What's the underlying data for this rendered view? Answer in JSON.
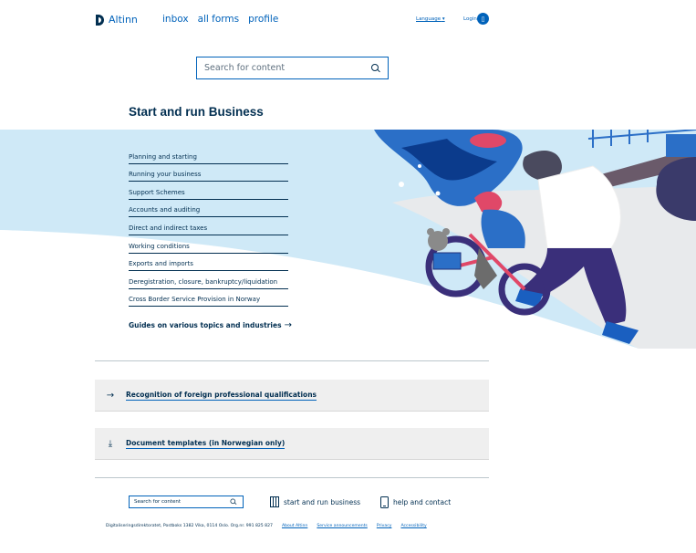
{
  "header": {
    "logo_text": "Altinn",
    "nav": [
      "inbox",
      "all forms",
      "profile"
    ],
    "language_label": "Language",
    "login_label": "Login"
  },
  "search": {
    "placeholder": "Search for content"
  },
  "page_title": "Start and run Business",
  "categories": [
    "Planning and starting",
    "Running your business",
    "Support Schemes",
    "Accounts and auditing",
    "Direct and indirect taxes",
    "Working conditions",
    "Exports and imports",
    "Deregistration, closure, bankruptcy/liquidation",
    "Cross Border Service Provision in Norway"
  ],
  "guides_link": "Guides on various topics and industries",
  "accordions": [
    {
      "label": "Recognition of foreign professional qualifications",
      "icon": "arrow-right-icon"
    },
    {
      "label": "Document templates (in Norwegian only)",
      "icon": "download-icon"
    }
  ],
  "footer": {
    "search_placeholder": "Search for content",
    "links": [
      "start and run business",
      "help and contact"
    ],
    "address": "Digitaliseringsdirektoratet, Postboks 1382 Vika, 0114 Oslo. Org.nr. 991 825 827",
    "bottom_links": [
      "About Altinn",
      "Service announcements",
      "Privacy",
      "Accessibility"
    ]
  },
  "colors": {
    "primary": "#022f51",
    "link": "#0062ba",
    "hero_bg": "#cfe9f7"
  }
}
